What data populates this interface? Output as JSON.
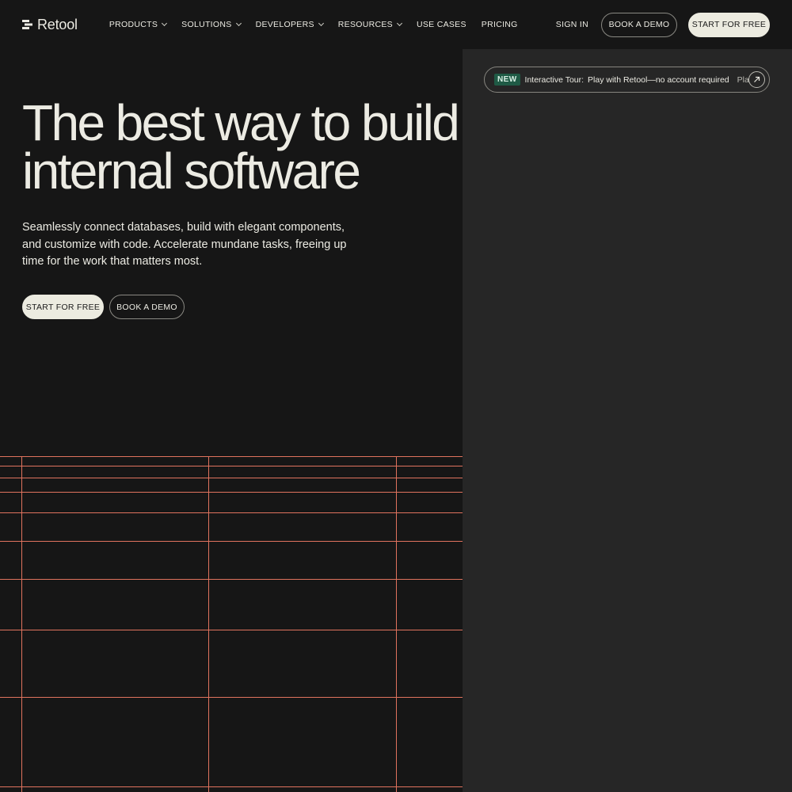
{
  "brand": {
    "name": "Retool"
  },
  "nav": {
    "links": [
      {
        "label": "PRODUCTS",
        "has_dropdown": true
      },
      {
        "label": "SOLUTIONS",
        "has_dropdown": true
      },
      {
        "label": "DEVELOPERS",
        "has_dropdown": true
      },
      {
        "label": "RESOURCES",
        "has_dropdown": true
      },
      {
        "label": "USE CASES",
        "has_dropdown": false
      },
      {
        "label": "PRICING",
        "has_dropdown": false
      }
    ],
    "sign_in": "SIGN IN",
    "book_demo": "BOOK A DEMO",
    "start_free": "START FOR FREE"
  },
  "hero": {
    "headline_line1": "The best way to build",
    "headline_line2": "internal software",
    "subtext": "Seamlessly connect databases, build with elegant components, and customize with code. Accelerate mundane tasks, freeing up time for the work that matters most.",
    "cta_primary": "START FOR FREE",
    "cta_secondary": "BOOK A DEMO"
  },
  "tour": {
    "badge": "NEW",
    "label": "Interactive Tour:",
    "text": "Play with Retool—no account required",
    "text_repeat": "Pla"
  },
  "colors": {
    "background": "#161616",
    "panel": "#262626",
    "cream": "#ecebe0",
    "grid_line": "#e0735e",
    "badge_green": "#1f5a45"
  }
}
